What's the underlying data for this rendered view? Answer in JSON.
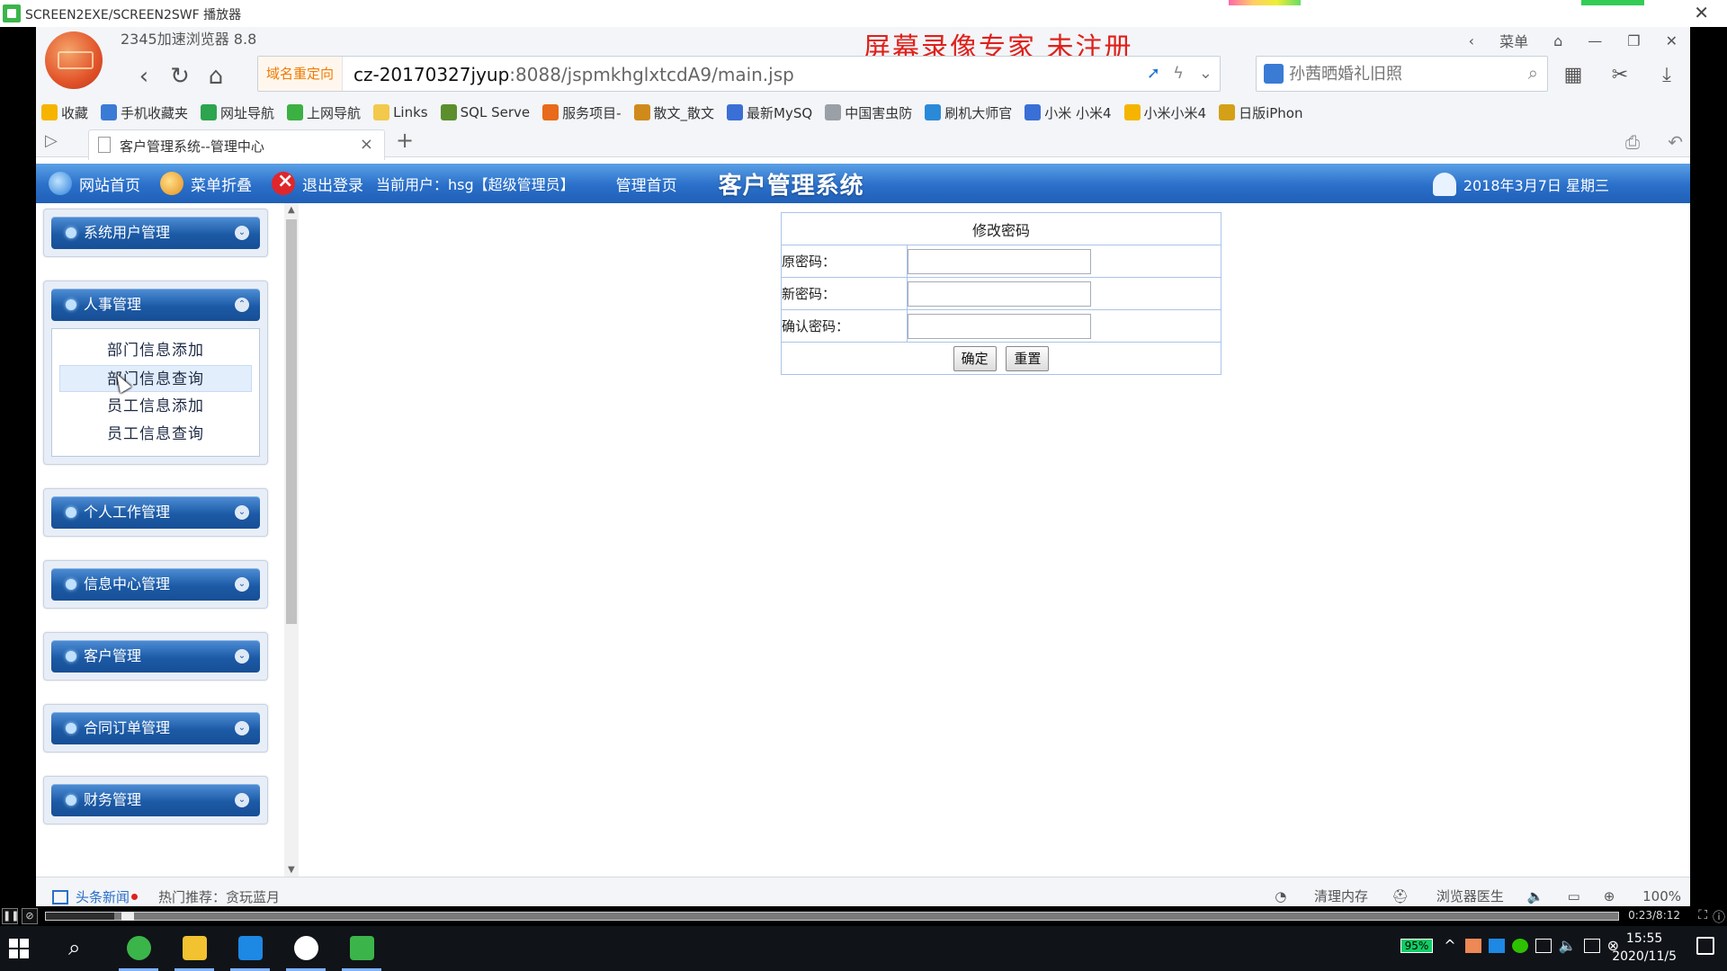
{
  "player": {
    "title": "SCREEN2EXE/SCREEN2SWF 播放器",
    "time": "0:23/8:12"
  },
  "browser": {
    "version": "2345加速浏览器 8.8",
    "watermark": "屏幕录像专家 未注册",
    "menu_label": "菜单",
    "redirect_label": "域名重定向",
    "url_host": "cz-20170327jyup",
    "url_rest": ":8088/jspmkhglxtcdA9/main.jsp",
    "search_placeholder": "孙茜晒婚礼旧照",
    "bookmarks": [
      {
        "label": "收藏",
        "color": "#f5b400"
      },
      {
        "label": "手机收藏夹",
        "color": "#3a7bd5"
      },
      {
        "label": "网址导航",
        "color": "#2da44e"
      },
      {
        "label": "上网导航",
        "color": "#3cb043"
      },
      {
        "label": "Links",
        "color": "#f2c94c"
      },
      {
        "label": "SQL Serve",
        "color": "#5a8f2c"
      },
      {
        "label": "服务项目-",
        "color": "#e86a1a"
      },
      {
        "label": "散文_散文",
        "color": "#d08a1c"
      },
      {
        "label": "最新MySQ",
        "color": "#3a6fd5"
      },
      {
        "label": "中国害虫防",
        "color": "#9aa0a6"
      },
      {
        "label": "刷机大师官",
        "color": "#2a8ad8"
      },
      {
        "label": "小米 小米4",
        "color": "#3a6fd5"
      },
      {
        "label": "小米小米4",
        "color": "#f5b400"
      },
      {
        "label": "日版iPhon",
        "color": "#d4a017"
      }
    ],
    "tab_title": "客户管理系统--管理中心",
    "status": {
      "news": "头条新闻",
      "hot": "热门推荐：贪玩蓝月",
      "clean": "清理内存",
      "doctor": "浏览器医生",
      "zoom": "100%"
    }
  },
  "app": {
    "nav_home": "网站首页",
    "nav_fold": "菜单折叠",
    "nav_logout": "退出登录",
    "current_user": "当前用户：hsg【超级管理员】",
    "admin_home": "管理首页",
    "title": "客户管理系统",
    "date": "2018年3月7日 星期三"
  },
  "sidebar": {
    "groups": [
      {
        "label": "系统用户管理",
        "expanded": false
      },
      {
        "label": "人事管理",
        "expanded": true,
        "items": [
          "部门信息添加",
          "部门信息查询",
          "员工信息添加",
          "员工信息查询"
        ]
      },
      {
        "label": "个人工作管理",
        "expanded": false
      },
      {
        "label": "信息中心管理",
        "expanded": false
      },
      {
        "label": "客户管理",
        "expanded": false
      },
      {
        "label": "合同订单管理",
        "expanded": false
      },
      {
        "label": "财务管理",
        "expanded": false
      }
    ]
  },
  "form": {
    "title": "修改密码",
    "old_label": "原密码：",
    "new_label": "新密码：",
    "confirm_label": "确认密码：",
    "ok": "确定",
    "reset": "重置"
  },
  "taskbar": {
    "battery": "95%",
    "time": "15:55",
    "date": "2020/11/5"
  }
}
